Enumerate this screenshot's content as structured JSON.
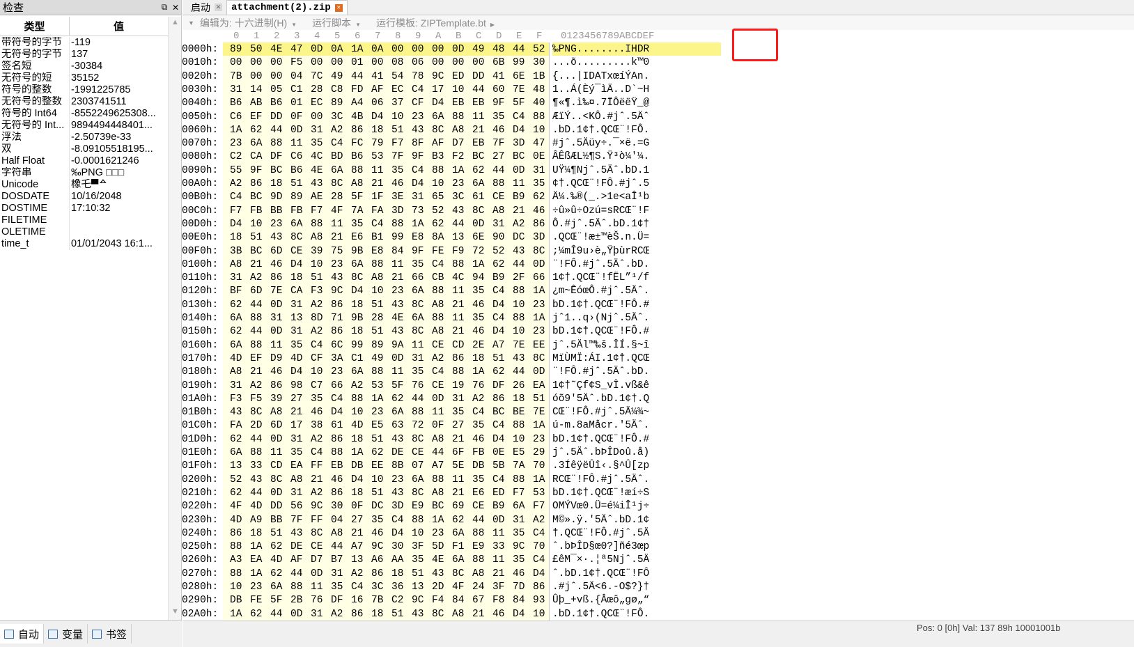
{
  "inspector": {
    "title": "检查",
    "col_type": "类型",
    "col_value": "值",
    "rows": [
      {
        "type": "带符号的字节",
        "value": "-119"
      },
      {
        "type": "无符号的字节",
        "value": "137"
      },
      {
        "type": "签名短",
        "value": "-30384"
      },
      {
        "type": "无符号的短",
        "value": "35152"
      },
      {
        "type": "符号的整数",
        "value": "-1991225785"
      },
      {
        "type": "无符号的整数",
        "value": "2303741511"
      },
      {
        "type": "符号的 Int64",
        "value": "-8552249625308..."
      },
      {
        "type": "无符号的 Int...",
        "value": "9894494448401..."
      },
      {
        "type": "浮法",
        "value": "-2.50739e-33"
      },
      {
        "type": "双",
        "value": "-8.09105518195..."
      },
      {
        "type": "Half Float",
        "value": "-0.0001621246"
      },
      {
        "type": "字符串",
        "value": "‰PNG □□□"
      },
      {
        "type": "Unicode",
        "value": "橡乇▀ᅀ"
      },
      {
        "type": "DOSDATE",
        "value": "10/16/2048"
      },
      {
        "type": "DOSTIME",
        "value": "17:10:32"
      },
      {
        "type": "FILETIME",
        "value": ""
      },
      {
        "type": "OLETIME",
        "value": ""
      },
      {
        "type": "time_t",
        "value": "01/01/2043 16:1..."
      }
    ],
    "tabs": [
      "自动",
      "变量",
      "书签"
    ]
  },
  "tabs": [
    {
      "label": "启动"
    },
    {
      "label": "attachment(2).zip"
    }
  ],
  "toolbar": {
    "edit_as": "编辑为: 十六进制(H)",
    "run_script": "运行脚本",
    "run_template": "运行模板: ZIPTemplate.bt"
  },
  "hex": {
    "col_labels": [
      "0",
      "1",
      "2",
      "3",
      "4",
      "5",
      "6",
      "7",
      "8",
      "9",
      "A",
      "B",
      "C",
      "D",
      "E",
      "F"
    ],
    "ascii_header": "0123456789ABCDEF",
    "rows": [
      {
        "addr": "0000h:",
        "bytes": [
          "89",
          "50",
          "4E",
          "47",
          "0D",
          "0A",
          "1A",
          "0A",
          "00",
          "00",
          "00",
          "0D",
          "49",
          "48",
          "44",
          "52"
        ],
        "ascii": "‰PNG........IHDR"
      },
      {
        "addr": "0010h:",
        "bytes": [
          "00",
          "00",
          "00",
          "F5",
          "00",
          "00",
          "01",
          "00",
          "08",
          "06",
          "00",
          "00",
          "00",
          "6B",
          "99",
          "30"
        ],
        "ascii": "...õ.........k™0"
      },
      {
        "addr": "0020h:",
        "bytes": [
          "7B",
          "00",
          "00",
          "04",
          "7C",
          "49",
          "44",
          "41",
          "54",
          "78",
          "9C",
          "ED",
          "DD",
          "41",
          "6E",
          "1B"
        ],
        "ascii": "{...|IDATxœíÝAn."
      },
      {
        "addr": "0030h:",
        "bytes": [
          "31",
          "14",
          "05",
          "C1",
          "28",
          "C8",
          "FD",
          "AF",
          "EC",
          "C4",
          "17",
          "10",
          "44",
          "60",
          "7E",
          "48"
        ],
        "ascii": "1..Á(Èý¯ìÄ..D`~H"
      },
      {
        "addr": "0040h:",
        "bytes": [
          "B6",
          "AB",
          "B6",
          "01",
          "EC",
          "89",
          "A4",
          "06",
          "37",
          "CF",
          "D4",
          "EB",
          "EB",
          "9F",
          "5F",
          "40"
        ],
        "ascii": "¶«¶.ì‰¤.7ÏÔëëŸ_@"
      },
      {
        "addr": "0050h:",
        "bytes": [
          "C6",
          "EF",
          "DD",
          "0F",
          "00",
          "3C",
          "4B",
          "D4",
          "10",
          "23",
          "6A",
          "88",
          "11",
          "35",
          "C4",
          "88"
        ],
        "ascii": "ÆïÝ..<KÔ.#jˆ.5Äˆ"
      },
      {
        "addr": "0060h:",
        "bytes": [
          "1A",
          "62",
          "44",
          "0D",
          "31",
          "A2",
          "86",
          "18",
          "51",
          "43",
          "8C",
          "A8",
          "21",
          "46",
          "D4",
          "10"
        ],
        "ascii": ".bD.1¢†.QCŒ¨!FÔ."
      },
      {
        "addr": "0070h:",
        "bytes": [
          "23",
          "6A",
          "88",
          "11",
          "35",
          "C4",
          "FC",
          "79",
          "F7",
          "8F",
          "AF",
          "D7",
          "EB",
          "7F",
          "3D",
          "47"
        ],
        "ascii": "#jˆ.5Äüy÷.¯×ë.=G"
      },
      {
        "addr": "0080h:",
        "bytes": [
          "C2",
          "CA",
          "DF",
          "C6",
          "4C",
          "BD",
          "B6",
          "53",
          "7F",
          "9F",
          "B3",
          "F2",
          "BC",
          "27",
          "BC",
          "0E"
        ],
        "ascii": "ÂÊßÆL½¶S.Ÿ³ò¼'¼."
      },
      {
        "addr": "0090h:",
        "bytes": [
          "55",
          "9F",
          "BC",
          "B6",
          "4E",
          "6A",
          "88",
          "11",
          "35",
          "C4",
          "88",
          "1A",
          "62",
          "44",
          "0D",
          "31"
        ],
        "ascii": "UŸ¼¶Njˆ.5Äˆ.bD.1"
      },
      {
        "addr": "00A0h:",
        "bytes": [
          "A2",
          "86",
          "18",
          "51",
          "43",
          "8C",
          "A8",
          "21",
          "46",
          "D4",
          "10",
          "23",
          "6A",
          "88",
          "11",
          "35"
        ],
        "ascii": "¢†.QCŒ¨!FÔ.#jˆ.5"
      },
      {
        "addr": "00B0h:",
        "bytes": [
          "C4",
          "BC",
          "9D",
          "89",
          "AE",
          "28",
          "5F",
          "1F",
          "3E",
          "31",
          "65",
          "3C",
          "61",
          "CE",
          "B9",
          "62"
        ],
        "ascii": "Ä¼.‰®(_.>1e<aÎ¹b"
      },
      {
        "addr": "00C0h:",
        "bytes": [
          "F7",
          "FB",
          "BB",
          "FB",
          "F7",
          "4F",
          "7A",
          "FA",
          "3D",
          "73",
          "52",
          "43",
          "8C",
          "A8",
          "21",
          "46"
        ],
        "ascii": "÷û»û÷Ozú=sRCŒ¨!F"
      },
      {
        "addr": "00D0h:",
        "bytes": [
          "D4",
          "10",
          "23",
          "6A",
          "88",
          "11",
          "35",
          "C4",
          "88",
          "1A",
          "62",
          "44",
          "0D",
          "31",
          "A2",
          "86"
        ],
        "ascii": "Ô.#jˆ.5Äˆ.bD.1¢†"
      },
      {
        "addr": "00E0h:",
        "bytes": [
          "18",
          "51",
          "43",
          "8C",
          "A8",
          "21",
          "E6",
          "B1",
          "99",
          "E8",
          "8A",
          "13",
          "6E",
          "90",
          "DC",
          "3D"
        ],
        "ascii": ".QCŒ¨!æ±™èŠ.n.Ü="
      },
      {
        "addr": "00F0h:",
        "bytes": [
          "3B",
          "BC",
          "6D",
          "CE",
          "39",
          "75",
          "9B",
          "E8",
          "84",
          "9F",
          "FE",
          "F9",
          "72",
          "52",
          "43",
          "8C"
        ],
        "ascii": ";¼mÎ9u›è„ŸþùrRCŒ"
      },
      {
        "addr": "0100h:",
        "bytes": [
          "A8",
          "21",
          "46",
          "D4",
          "10",
          "23",
          "6A",
          "88",
          "11",
          "35",
          "C4",
          "88",
          "1A",
          "62",
          "44",
          "0D"
        ],
        "ascii": "¨!FÔ.#jˆ.5Äˆ.bD."
      },
      {
        "addr": "0110h:",
        "bytes": [
          "31",
          "A2",
          "86",
          "18",
          "51",
          "43",
          "8C",
          "A8",
          "21",
          "66",
          "CB",
          "4C",
          "94",
          "B9",
          "2F",
          "66"
        ],
        "ascii": "1¢†.QCŒ¨!fËL”¹/f"
      },
      {
        "addr": "0120h:",
        "bytes": [
          "BF",
          "6D",
          "7E",
          "CA",
          "F3",
          "9C",
          "D4",
          "10",
          "23",
          "6A",
          "88",
          "11",
          "35",
          "C4",
          "88",
          "1A"
        ],
        "ascii": "¿m~ÊóœÔ.#jˆ.5Äˆ."
      },
      {
        "addr": "0130h:",
        "bytes": [
          "62",
          "44",
          "0D",
          "31",
          "A2",
          "86",
          "18",
          "51",
          "43",
          "8C",
          "A8",
          "21",
          "46",
          "D4",
          "10",
          "23"
        ],
        "ascii": "bD.1¢†.QCŒ¨!FÔ.#"
      },
      {
        "addr": "0140h:",
        "bytes": [
          "6A",
          "88",
          "31",
          "13",
          "8D",
          "71",
          "9B",
          "28",
          "4E",
          "6A",
          "88",
          "11",
          "35",
          "C4",
          "88",
          "1A"
        ],
        "ascii": "jˆ1..q›(Njˆ.5Äˆ."
      },
      {
        "addr": "0150h:",
        "bytes": [
          "62",
          "44",
          "0D",
          "31",
          "A2",
          "86",
          "18",
          "51",
          "43",
          "8C",
          "A8",
          "21",
          "46",
          "D4",
          "10",
          "23"
        ],
        "ascii": "bD.1¢†.QCŒ¨!FÔ.#"
      },
      {
        "addr": "0160h:",
        "bytes": [
          "6A",
          "88",
          "11",
          "35",
          "C4",
          "6C",
          "99",
          "89",
          "9A",
          "11",
          "CE",
          "CD",
          "2E",
          "A7",
          "7E",
          "EE"
        ],
        "ascii": "jˆ.5Äl™‰š.ÎÍ.§~î"
      },
      {
        "addr": "0170h:",
        "bytes": [
          "4D",
          "EF",
          "D9",
          "4D",
          "CF",
          "3A",
          "C1",
          "49",
          "0D",
          "31",
          "A2",
          "86",
          "18",
          "51",
          "43",
          "8C"
        ],
        "ascii": "MïÙMÏ:ÁI.1¢†.QCŒ"
      },
      {
        "addr": "0180h:",
        "bytes": [
          "A8",
          "21",
          "46",
          "D4",
          "10",
          "23",
          "6A",
          "88",
          "11",
          "35",
          "C4",
          "88",
          "1A",
          "62",
          "44",
          "0D"
        ],
        "ascii": "¨!FÔ.#jˆ.5Äˆ.bD."
      },
      {
        "addr": "0190h:",
        "bytes": [
          "31",
          "A2",
          "86",
          "98",
          "C7",
          "66",
          "A2",
          "53",
          "5F",
          "76",
          "CE",
          "19",
          "76",
          "DF",
          "26",
          "EA"
        ],
        "ascii": "1¢†˜Çf¢S_vÎ.vß&ê"
      },
      {
        "addr": "01A0h:",
        "bytes": [
          "F3",
          "F5",
          "39",
          "27",
          "35",
          "C4",
          "88",
          "1A",
          "62",
          "44",
          "0D",
          "31",
          "A2",
          "86",
          "18",
          "51"
        ],
        "ascii": "óõ9'5Äˆ.bD.1¢†.Q"
      },
      {
        "addr": "01B0h:",
        "bytes": [
          "43",
          "8C",
          "A8",
          "21",
          "46",
          "D4",
          "10",
          "23",
          "6A",
          "88",
          "11",
          "35",
          "C4",
          "BC",
          "BE",
          "7E"
        ],
        "ascii": "CŒ¨!FÔ.#jˆ.5Ä¼¾~"
      },
      {
        "addr": "01C0h:",
        "bytes": [
          "FA",
          "2D",
          "6D",
          "17",
          "38",
          "61",
          "4D",
          "E5",
          "63",
          "72",
          "0F",
          "27",
          "35",
          "C4",
          "88",
          "1A"
        ],
        "ascii": "ú-m.8aMåcr.'5Äˆ."
      },
      {
        "addr": "01D0h:",
        "bytes": [
          "62",
          "44",
          "0D",
          "31",
          "A2",
          "86",
          "18",
          "51",
          "43",
          "8C",
          "A8",
          "21",
          "46",
          "D4",
          "10",
          "23"
        ],
        "ascii": "bD.1¢†.QCŒ¨!FÔ.#"
      },
      {
        "addr": "01E0h:",
        "bytes": [
          "6A",
          "88",
          "11",
          "35",
          "C4",
          "88",
          "1A",
          "62",
          "DE",
          "CE",
          "44",
          "6F",
          "FB",
          "0E",
          "E5",
          "29"
        ],
        "ascii": "jˆ.5Äˆ.bÞÎDoû.å)"
      },
      {
        "addr": "01F0h:",
        "bytes": [
          "13",
          "33",
          "CD",
          "EA",
          "FF",
          "EB",
          "DB",
          "EE",
          "8B",
          "07",
          "A7",
          "5E",
          "DB",
          "5B",
          "7A",
          "70"
        ],
        "ascii": ".3ÍêÿëÛî‹.§^Û[zp"
      },
      {
        "addr": "0200h:",
        "bytes": [
          "52",
          "43",
          "8C",
          "A8",
          "21",
          "46",
          "D4",
          "10",
          "23",
          "6A",
          "88",
          "11",
          "35",
          "C4",
          "88",
          "1A"
        ],
        "ascii": "RCŒ¨!FÔ.#jˆ.5Äˆ."
      },
      {
        "addr": "0210h:",
        "bytes": [
          "62",
          "44",
          "0D",
          "31",
          "A2",
          "86",
          "18",
          "51",
          "43",
          "8C",
          "A8",
          "21",
          "E6",
          "ED",
          "F7",
          "53"
        ],
        "ascii": "bD.1¢†.QCŒ¨!æí÷S"
      },
      {
        "addr": "0220h:",
        "bytes": [
          "4F",
          "4D",
          "DD",
          "56",
          "9C",
          "30",
          "0F",
          "DC",
          "3D",
          "E9",
          "BC",
          "69",
          "CE",
          "B9",
          "6A",
          "F7"
        ],
        "ascii": "OMÝVœ0.Ü=é¼iÎ¹j÷"
      },
      {
        "addr": "0230h:",
        "bytes": [
          "4D",
          "A9",
          "BB",
          "7F",
          "FF",
          "04",
          "27",
          "35",
          "C4",
          "88",
          "1A",
          "62",
          "44",
          "0D",
          "31",
          "A2"
        ],
        "ascii": "M©».ÿ.'5Äˆ.bD.1¢"
      },
      {
        "addr": "0240h:",
        "bytes": [
          "86",
          "18",
          "51",
          "43",
          "8C",
          "A8",
          "21",
          "46",
          "D4",
          "10",
          "23",
          "6A",
          "88",
          "11",
          "35",
          "C4"
        ],
        "ascii": "†.QCŒ¨!FÔ.#jˆ.5Ä"
      },
      {
        "addr": "0250h:",
        "bytes": [
          "88",
          "1A",
          "62",
          "DE",
          "CE",
          "44",
          "A7",
          "9C",
          "30",
          "3F",
          "5D",
          "F1",
          "E9",
          "33",
          "9C",
          "70"
        ],
        "ascii": "ˆ.bÞÎD§œ0?]ñé3œp"
      },
      {
        "addr": "0260h:",
        "bytes": [
          "A3",
          "EA",
          "4D",
          "AF",
          "D7",
          "B7",
          "13",
          "A6",
          "AA",
          "35",
          "4E",
          "6A",
          "88",
          "11",
          "35",
          "C4"
        ],
        "ascii": "£êM¯×·.¦ª5Njˆ.5Ä"
      },
      {
        "addr": "0270h:",
        "bytes": [
          "88",
          "1A",
          "62",
          "44",
          "0D",
          "31",
          "A2",
          "86",
          "18",
          "51",
          "43",
          "8C",
          "A8",
          "21",
          "46",
          "D4"
        ],
        "ascii": "ˆ.bD.1¢†.QCŒ¨!FÔ"
      },
      {
        "addr": "0280h:",
        "bytes": [
          "10",
          "23",
          "6A",
          "88",
          "11",
          "35",
          "C4",
          "3C",
          "36",
          "13",
          "2D",
          "4F",
          "24",
          "3F",
          "7D",
          "86"
        ],
        "ascii": ".#jˆ.5Ä<6.-O$?}†"
      },
      {
        "addr": "0290h:",
        "bytes": [
          "DB",
          "FE",
          "5F",
          "2B",
          "76",
          "DF",
          "16",
          "7B",
          "C2",
          "9C",
          "F4",
          "84",
          "67",
          "F8",
          "84",
          "93"
        ],
        "ascii": "Ûþ_+vß.{Âœô„gø„“"
      },
      {
        "addr": "02A0h:",
        "bytes": [
          "1A",
          "62",
          "44",
          "0D",
          "31",
          "A2",
          "86",
          "18",
          "51",
          "43",
          "8C",
          "A8",
          "21",
          "46",
          "D4",
          "10"
        ],
        "ascii": ".bD.1¢†.QCŒ¨!FÔ."
      }
    ]
  },
  "status": {
    "text": "Pos: 0 [0h]    Val: 137 89h 10001001b"
  }
}
